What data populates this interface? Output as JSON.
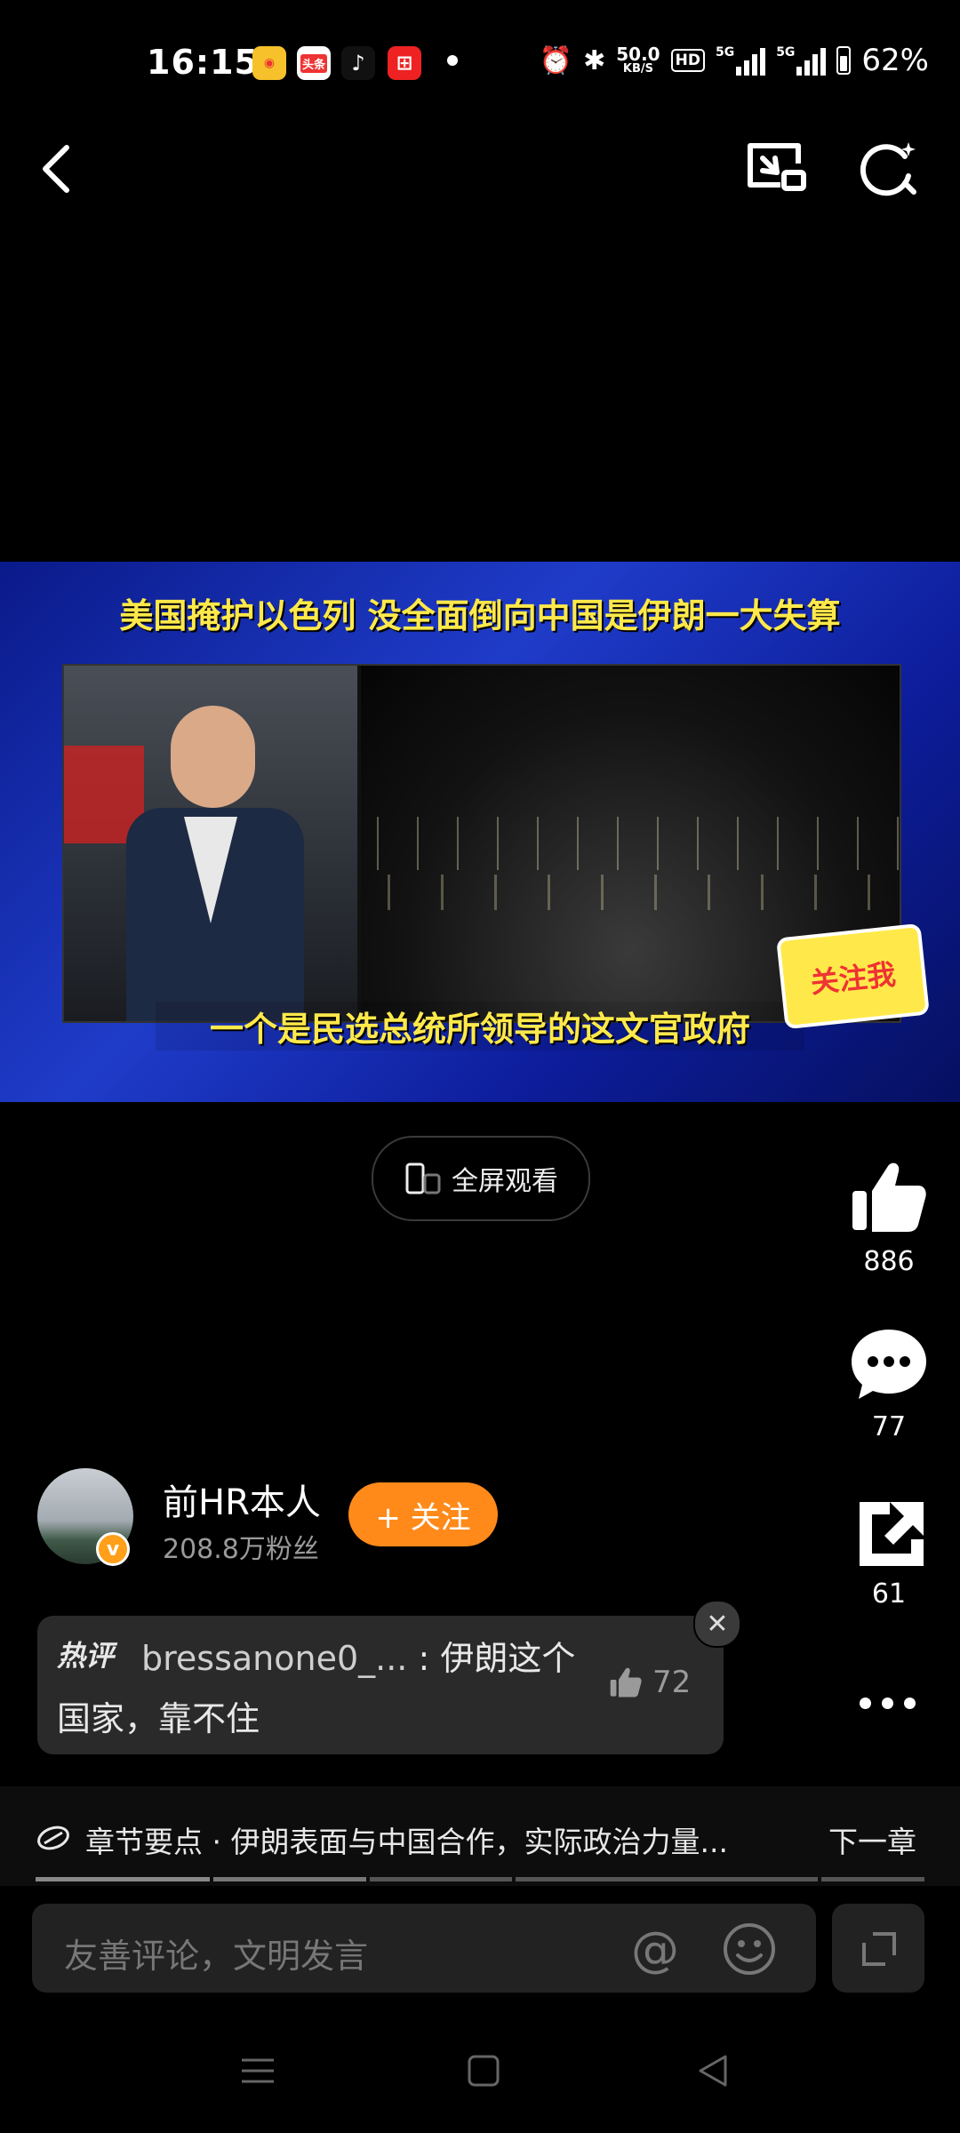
{
  "status_bar": {
    "time": "16:15",
    "apps": [
      "头条"
    ],
    "net_speed": "50.0",
    "net_unit": "KB/S",
    "hd_label": "HD",
    "sig1_label": "5G",
    "sig2_label": "5G",
    "battery": "62%"
  },
  "video": {
    "headline": "美国掩护以色列 没全面倒向中国是伊朗一大失算",
    "subtitle": "一个是民选总统所领导的这文官政府",
    "stamp": "关注我"
  },
  "fullscreen_label": "全屏观看",
  "actions": {
    "likes": "886",
    "comments": "77",
    "shares": "61"
  },
  "author": {
    "name": "前HR本人",
    "fans": "208.8万粉丝",
    "follow_label": "+ 关注",
    "badge": "v"
  },
  "hot_comment": {
    "tag": "热评",
    "user": "bressanone0_...",
    "text": " : 伊朗这个国家，靠不住",
    "likes": "72"
  },
  "chapter": {
    "text": "章节要点 · 伊朗表面与中国合作，实际政治力量...",
    "next": "下一章"
  },
  "comment_input": {
    "placeholder": "友善评论，文明发言"
  },
  "colors": {
    "accent": "#ff8a1a",
    "background": "#000000",
    "headline_yellow": "#ffe94a"
  }
}
